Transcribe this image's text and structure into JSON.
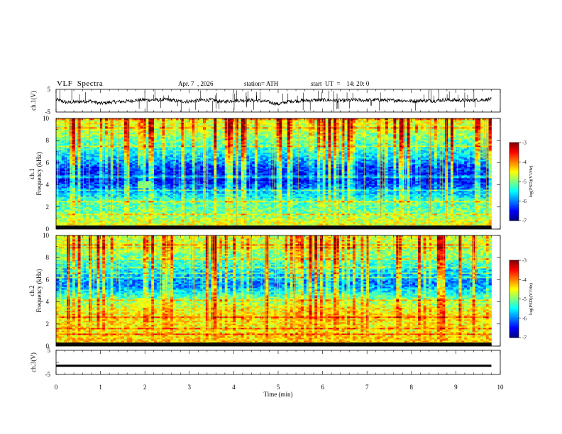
{
  "header": {
    "title": "VLF  Spectra",
    "date": "Apr. 7  , 2026",
    "station": "station= ATH",
    "start": "start  UT  =    14: 20: 0"
  },
  "chart_data": [
    {
      "type": "line",
      "panel": "ch1-waveform",
      "ylabel": "ch.1(V)",
      "ylim": [
        -5,
        5
      ],
      "yticks": [
        "5",
        "-5"
      ],
      "x": [
        0,
        0.25,
        0.5,
        0.75,
        1,
        1.25,
        1.5,
        1.75,
        2,
        2.25,
        2.5,
        2.75,
        3,
        3.25,
        3.5,
        3.75,
        4,
        4.25,
        4.5,
        4.75,
        5,
        5.25,
        5.5,
        5.75,
        6,
        6.25,
        6.5,
        6.75,
        7,
        7.25,
        7.5,
        7.75,
        8,
        8.25,
        8.5,
        8.75,
        9,
        9.25,
        9.5,
        9.8
      ],
      "y": [
        0.5,
        -0.8,
        -0.5,
        -0.1,
        -1.2,
        -0.6,
        -0.4,
        0.1,
        0.4,
        0.3,
        0.5,
        -0.2,
        -0.3,
        0.2,
        0.3,
        -0.5,
        0.1,
        0.2,
        0.1,
        -0.4,
        -1.5,
        -0.3,
        0.0,
        0.2,
        0.3,
        0.2,
        0.0,
        0.3,
        0.2,
        0.4,
        0.1,
        0.2,
        -0.2,
        0.1,
        0.0,
        0.4,
        0.2,
        0.1,
        0.3,
        0.6
      ]
    },
    {
      "type": "heatmap",
      "panel": "ch1-spectrogram",
      "ylabel": "ch.1\nFrequency  (kHz)",
      "ylim": [
        0,
        10
      ],
      "yticks": [
        "0",
        "2",
        "4",
        "6",
        "8",
        "10"
      ],
      "xlim": [
        0,
        9.8
      ],
      "colorbar_label": "log(PSD)(V²/Hz)",
      "colorbar_ticks": [
        "-3",
        "-4",
        "-5",
        "-6",
        "-7"
      ],
      "colorbar_range": [
        -7,
        -3
      ],
      "freq_khz": [
        0.5,
        1.5,
        2.5,
        3.5,
        4.5,
        5.5,
        6.5,
        7.5,
        8.5,
        9.5
      ],
      "mean_log_psd": [
        -4.6,
        -5.1,
        -5.2,
        -5.9,
        -6.5,
        -6.3,
        -5.7,
        -5.3,
        -4.9,
        -4.6
      ],
      "features": [
        {
          "label": "",
          "time_min": [
            1.85,
            2.15
          ],
          "freq_khz": [
            3.7,
            4.4
          ],
          "log_psd": -5.0
        }
      ]
    },
    {
      "type": "heatmap",
      "panel": "ch2-spectrogram",
      "ylabel": "ch.2\nFrequency  (kHz)",
      "ylim": [
        0,
        10
      ],
      "yticks": [
        "0",
        "2",
        "4",
        "6",
        "8",
        "10"
      ],
      "xlim": [
        0,
        9.8
      ],
      "colorbar_label": "log(PSD)(V²/Hz)",
      "colorbar_ticks": [
        "-3",
        "-4",
        "-5",
        "-6",
        "-7"
      ],
      "colorbar_range": [
        -7,
        -3
      ],
      "freq_khz": [
        0.5,
        1.5,
        2.5,
        3.5,
        4.5,
        5.5,
        6.5,
        7.5,
        8.5,
        9.5
      ],
      "mean_log_psd": [
        -4.3,
        -4.5,
        -4.4,
        -4.6,
        -5.2,
        -6.0,
        -5.8,
        -5.3,
        -4.9,
        -4.7
      ],
      "features": [
        {
          "label": "",
          "time_min": [
            1.85,
            2.15
          ],
          "freq_khz": [
            3.5,
            4.3
          ],
          "log_psd": -4.5
        }
      ]
    },
    {
      "type": "line",
      "panel": "ch3-waveform",
      "ylabel": "ch.3(V)",
      "ylim": [
        -5,
        5
      ],
      "yticks": [
        "5",
        "0",
        "-5"
      ],
      "x": [
        0,
        9.8
      ],
      "y": [
        -1.4,
        -1.4
      ]
    }
  ],
  "xaxis": {
    "label": "Time  (min)",
    "ticks": [
      "0",
      "1",
      "2",
      "3",
      "4",
      "5",
      "6",
      "7",
      "8",
      "9",
      "10"
    ],
    "xlim": [
      0,
      10
    ]
  }
}
